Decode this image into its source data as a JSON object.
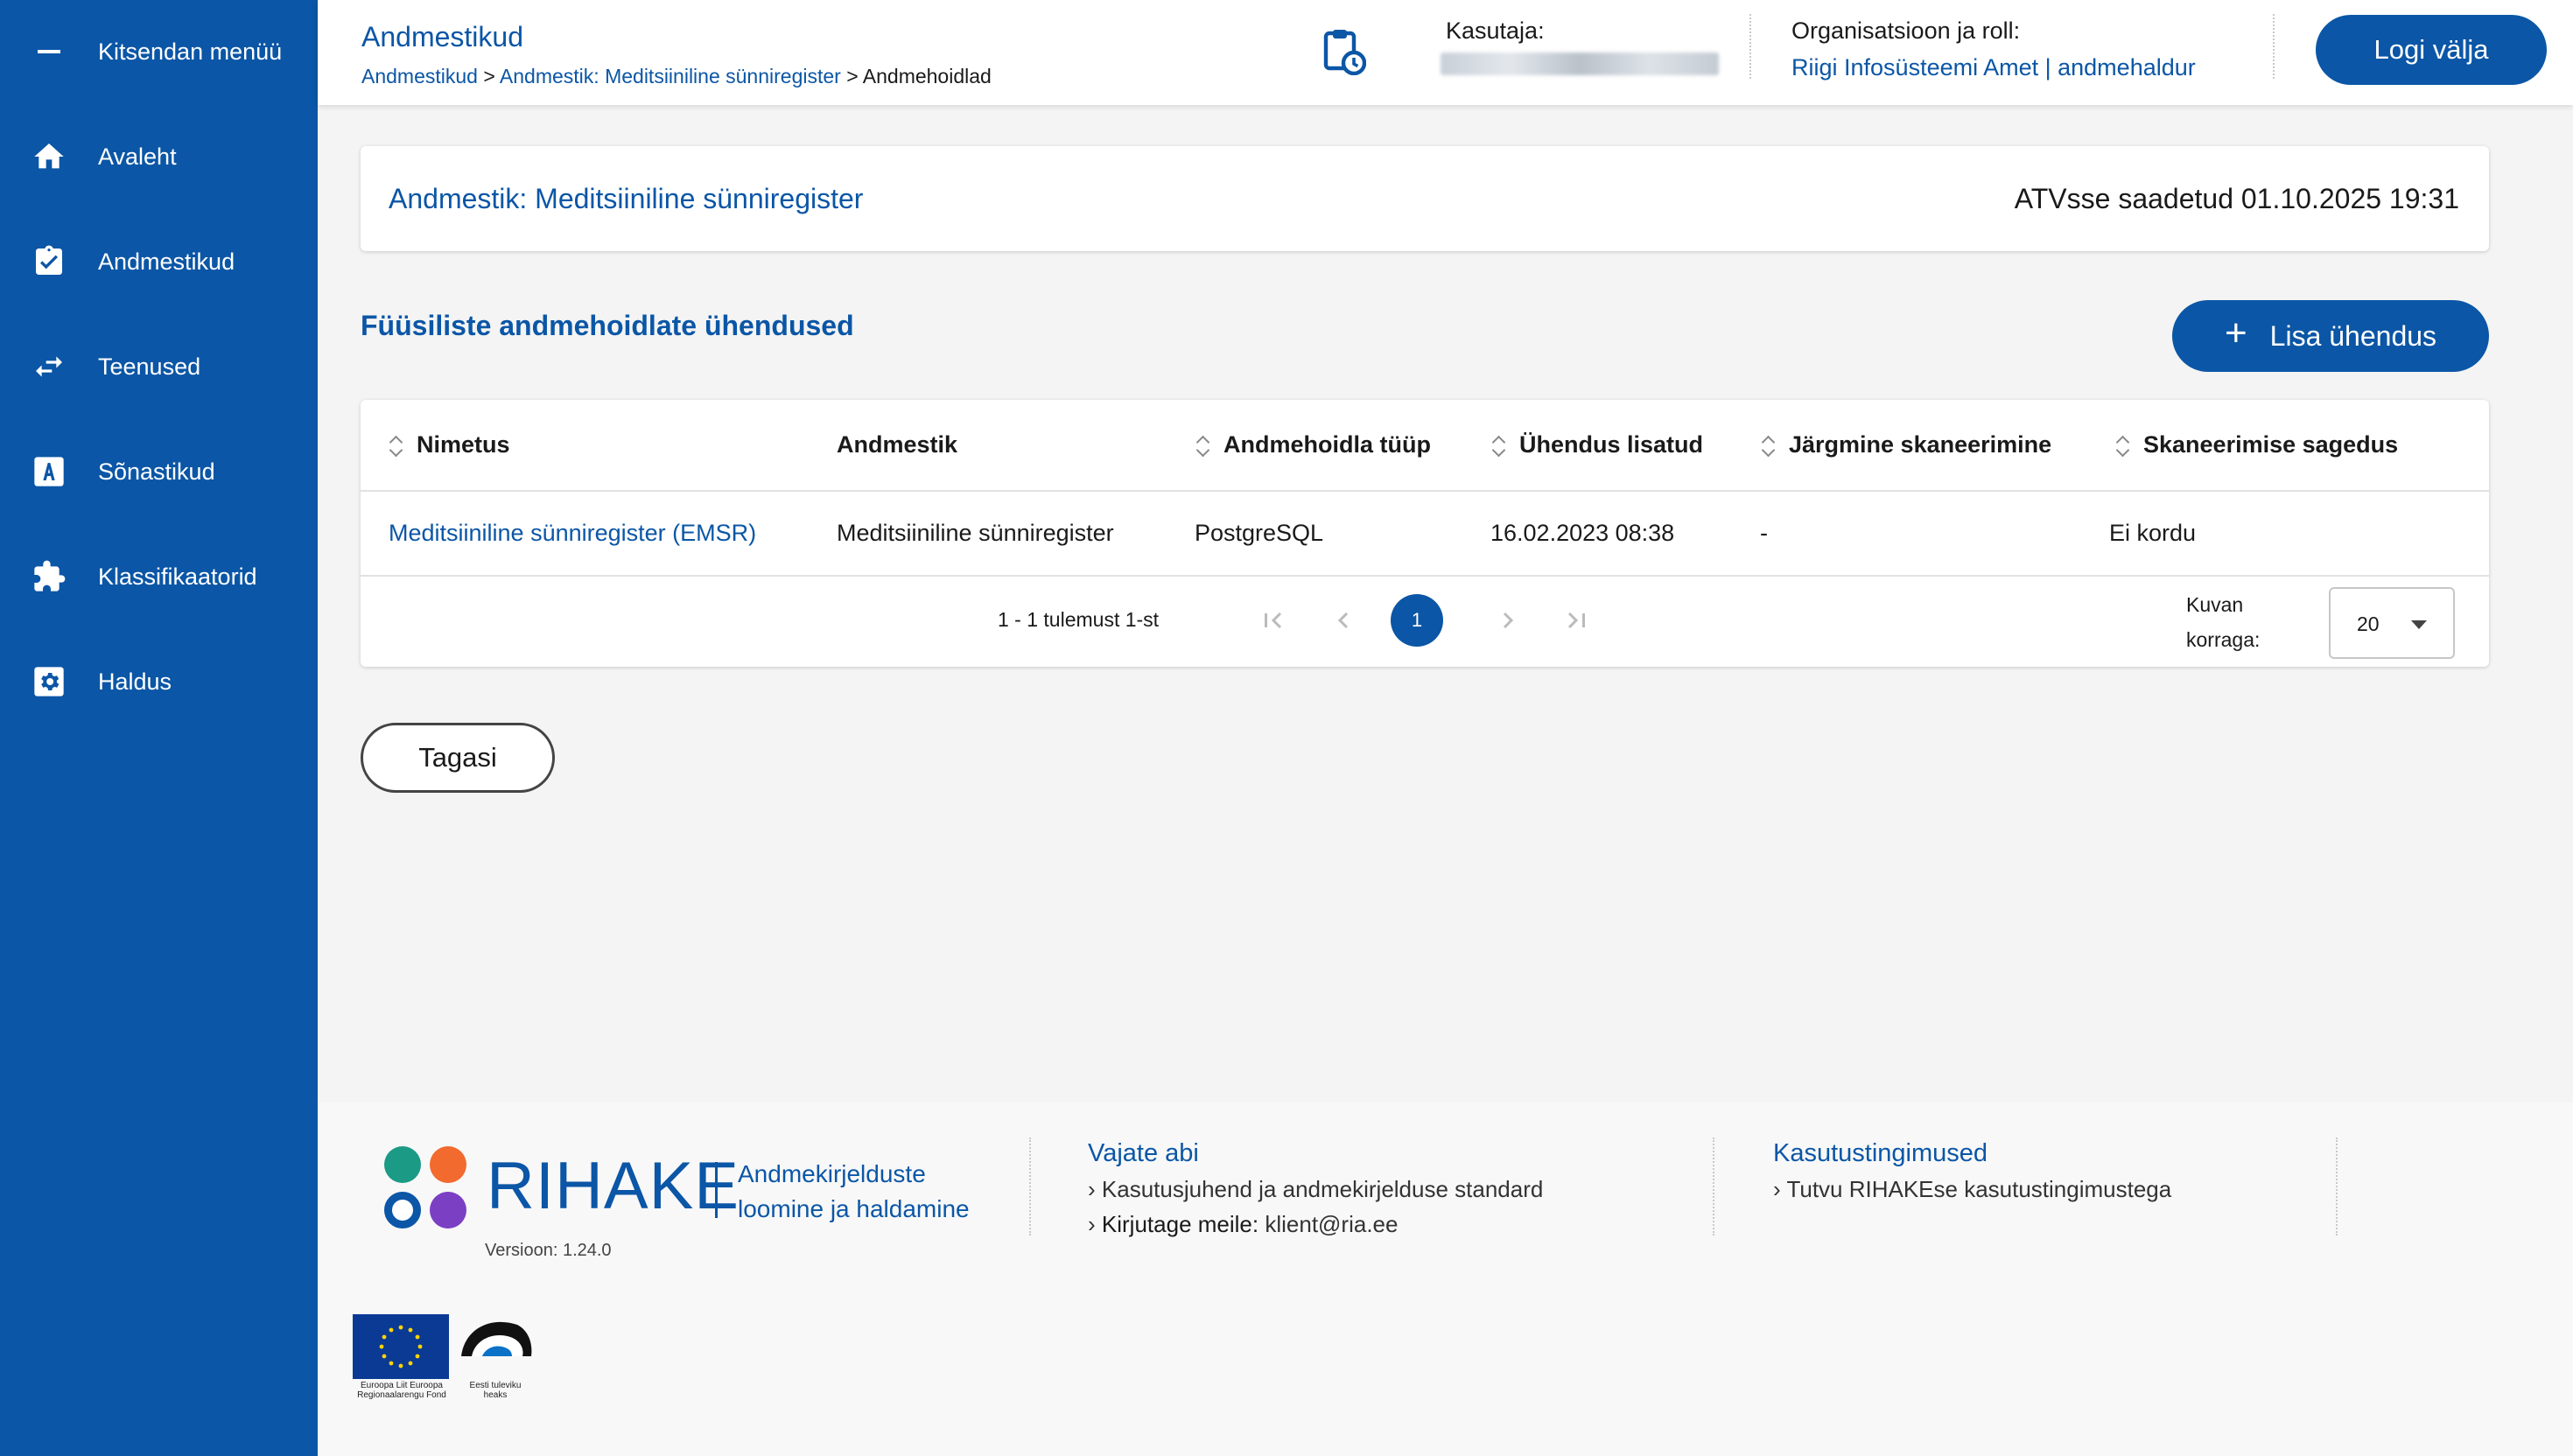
{
  "sidebar": {
    "collapse_label": "Kitsendan menüü",
    "items": [
      {
        "label": "Avaleht",
        "icon": "home-icon"
      },
      {
        "label": "Andmestikud",
        "icon": "clipboard-check-icon"
      },
      {
        "label": "Teenused",
        "icon": "swap-arrows-icon"
      },
      {
        "label": "Sõnastikud",
        "icon": "letter-a-icon"
      },
      {
        "label": "Klassifikaatorid",
        "icon": "puzzle-icon"
      },
      {
        "label": "Haldus",
        "icon": "gear-icon"
      }
    ]
  },
  "header": {
    "title": "Andmestikud",
    "breadcrumb": {
      "items": [
        "Andmestikud",
        "Andmestik: Meditsiiniline sünniregister"
      ],
      "current": "Andmehoidlad",
      "separator": ">"
    },
    "user_label": "Kasutaja:",
    "org_label": "Organisatsioon ja roll:",
    "org_value": "Riigi Infosüsteemi Amet | andmehaldur",
    "logout_label": "Logi välja"
  },
  "dataset": {
    "title": "Andmestik: Meditsiiniline sünniregister",
    "status": "ATVsse saadetud 01.10.2025 19:31"
  },
  "section": {
    "title": "Füüsiliste andmehoidlate ühendused",
    "add_label": "Lisa ühendus"
  },
  "table": {
    "columns": [
      "Nimetus",
      "Andmestik",
      "Andmehoidla tüüp",
      "Ühendus lisatud",
      "Järgmine skaneerimine",
      "Skaneerimise sagedus"
    ],
    "rows": [
      [
        "Meditsiiniline sünniregister (EMSR)",
        "Meditsiiniline sünniregister",
        "PostgreSQL",
        "16.02.2023 08:38",
        "-",
        "Ei kordu"
      ]
    ],
    "pagination": {
      "summary": "1 - 1 tulemust 1-st",
      "current_page": "1",
      "per_page_label": "Kuvan korraga:",
      "per_page_value": "20"
    }
  },
  "back_label": "Tagasi",
  "footer": {
    "brand": "RIHAKE",
    "tagline": "Andmekirjelduste loomine ja haldamine",
    "version": "Versioon: 1.24.0",
    "help": {
      "title": "Vajate abi",
      "link1": "Kasutusjuhend ja andmekirjelduse standard",
      "mail_label": "Kirjutage meile:",
      "mail_value": "klient@ria.ee"
    },
    "terms": {
      "title": "Kasutustingimused",
      "link": "Tutvu RIHAKEse kasutustingimustega"
    },
    "eu_text": "Euroopa Liit Euroopa Regionaalarengu Fond",
    "ee_text": "Eesti tuleviku heaks"
  },
  "colors": {
    "primary": "#0b56a6",
    "dot_teal": "#1b9a86",
    "dot_orange": "#f26a2e",
    "dot_blue": "#0b56a6",
    "dot_purple": "#7b3fc4"
  }
}
